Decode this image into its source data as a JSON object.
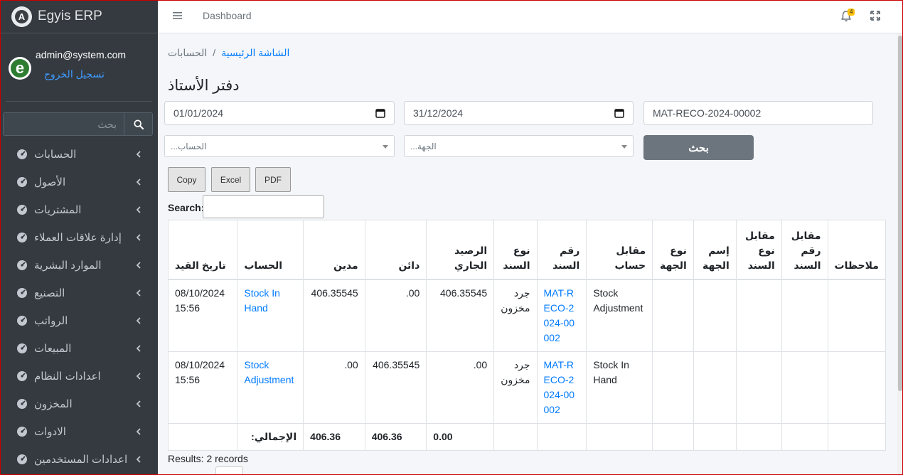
{
  "brand": {
    "name": "Egyis ERP",
    "logo_letter": "A"
  },
  "user": {
    "email": "admin@system.com",
    "logout_label": "تسجيل الخروج",
    "avatar_letter": "e"
  },
  "sidebar": {
    "search_placeholder": "بحث",
    "items": [
      {
        "label": "الحسابات",
        "icon": "gauge-icon"
      },
      {
        "label": "الأصول",
        "icon": "gauge-icon"
      },
      {
        "label": "المشتريات",
        "icon": "gauge-icon"
      },
      {
        "label": "إدارة علاقات العملاء",
        "icon": "gauge-icon"
      },
      {
        "label": "الموارد البشرية",
        "icon": "gauge-icon"
      },
      {
        "label": "التصنيع",
        "icon": "gauge-icon"
      },
      {
        "label": "الرواتب",
        "icon": "gauge-icon"
      },
      {
        "label": "المبيعات",
        "icon": "gauge-icon"
      },
      {
        "label": "اعدادات النظام",
        "icon": "gauge-icon"
      },
      {
        "label": "المخزون",
        "icon": "gauge-icon"
      },
      {
        "label": "الادوات",
        "icon": "gauge-icon"
      },
      {
        "label": "اعدادات المستخدمين",
        "icon": "gauge-icon"
      }
    ]
  },
  "topbar": {
    "link": "Dashboard",
    "notification_count": "4"
  },
  "breadcrumb": {
    "home": "الشاشة الرئيسية",
    "current": "الحسابات"
  },
  "page": {
    "title": "دفتر الأستاذ"
  },
  "filters": {
    "date_from": "01/01/2024",
    "date_to": "31/12/2024",
    "reference": "MAT-RECO-2024-00002",
    "account_placeholder": "الحساب...",
    "party_placeholder": "الجهة...",
    "search_button": "بحث"
  },
  "export_buttons": {
    "copy": "Copy",
    "excel": "Excel",
    "pdf": "PDF"
  },
  "table_search_label": "Search:",
  "table": {
    "headers": {
      "date": "تاريخ القيد",
      "account": "الحساب",
      "debit": "مدين",
      "credit": "دائن",
      "balance": "الرصيد الجاري",
      "voucher_type": "نوع السند",
      "voucher_no": "رقم السند",
      "against_account": "مقابل حساب",
      "party_type": "نوع الجهة",
      "party_name": "إسم الجهة",
      "against_voucher_type": "مقابل نوع السند",
      "against_voucher_no": "مقابل رقم السند",
      "remarks": "ملاحظات"
    },
    "rows": [
      {
        "date": "08/10/2024 15:56",
        "account": "Stock In Hand",
        "debit": "406.35545",
        "credit": ".00",
        "balance": "406.35545",
        "voucher_type": "جرد مخزون",
        "voucher_no": "MAT-RECO-2024-00002",
        "against_account": "Stock Adjustment",
        "party_type": "",
        "party_name": "",
        "against_voucher_type": "",
        "against_voucher_no": "",
        "remarks": ""
      },
      {
        "date": "08/10/2024 15:56",
        "account": "Stock Adjustment",
        "debit": ".00",
        "credit": "406.35545",
        "balance": ".00",
        "voucher_type": "جرد مخزون",
        "voucher_no": "MAT-RECO-2024-00002",
        "against_account": "Stock In Hand",
        "party_type": "",
        "party_name": "",
        "against_voucher_type": "",
        "against_voucher_no": "",
        "remarks": ""
      }
    ],
    "footer": {
      "label": ":الإجمالي",
      "debit_total": "406.36",
      "credit_total": "406.36",
      "balance_total": "0.00"
    }
  },
  "results_text": "Results: 2 records",
  "colors": {
    "sidebar_bg": "#343a40",
    "link": "#007bff",
    "search_button": "#6c757d",
    "badge": "#ffc107"
  }
}
